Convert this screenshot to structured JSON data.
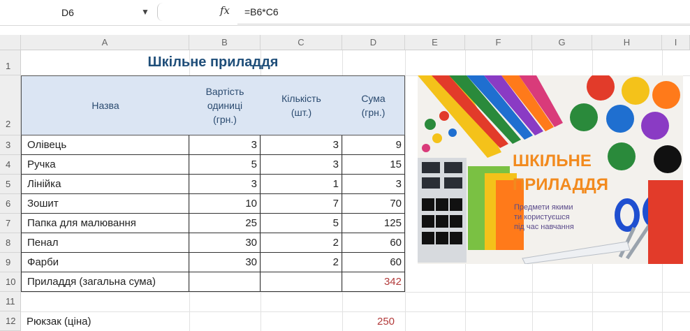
{
  "formula_bar": {
    "cell_ref": "D6",
    "fx": "fx",
    "formula": "=B6*C6"
  },
  "columns": [
    "A",
    "B",
    "C",
    "D",
    "E",
    "F",
    "G",
    "H",
    "I"
  ],
  "rows": [
    "1",
    "2",
    "3",
    "4",
    "5",
    "6",
    "7",
    "8",
    "9",
    "10",
    "11",
    "12"
  ],
  "title": "Шкільне приладдя",
  "headers": {
    "name": "Назва",
    "unit_cost": [
      "Вартість",
      "одиниці",
      "(грн.)"
    ],
    "qty": [
      "Кількість",
      "(шт.)"
    ],
    "sum": [
      "Сума",
      "(грн.)"
    ]
  },
  "items": [
    {
      "name": "Олівець",
      "price": "3",
      "qty": "3",
      "sum": "9"
    },
    {
      "name": "Ручка",
      "price": "5",
      "qty": "3",
      "sum": "15"
    },
    {
      "name": "Лінійка",
      "price": "3",
      "qty": "1",
      "sum": "3"
    },
    {
      "name": "Зошит",
      "price": "10",
      "qty": "7",
      "sum": "70"
    },
    {
      "name": "Папка для малювання",
      "price": "25",
      "qty": "5",
      "sum": "125"
    },
    {
      "name": "Пенал",
      "price": "30",
      "qty": "2",
      "sum": "60"
    },
    {
      "name": "Фарби",
      "price": "30",
      "qty": "2",
      "sum": "60"
    }
  ],
  "total": {
    "label": "Приладдя (загальна сума)",
    "sum": "342"
  },
  "backpack": {
    "label": "Рюкзак (ціна)",
    "value": "250"
  },
  "poster": {
    "title1": "ШКІЛЬНЕ",
    "title2": "ПРИЛАДДЯ",
    "lines": [
      "Предмети якими",
      "ти користуєшся",
      "під час навчання"
    ]
  },
  "colors": {
    "header_fill": "#dbe5f3",
    "title": "#1f4e79",
    "red_value": "#b23a3a",
    "poster_orange": "#f28a1e"
  }
}
